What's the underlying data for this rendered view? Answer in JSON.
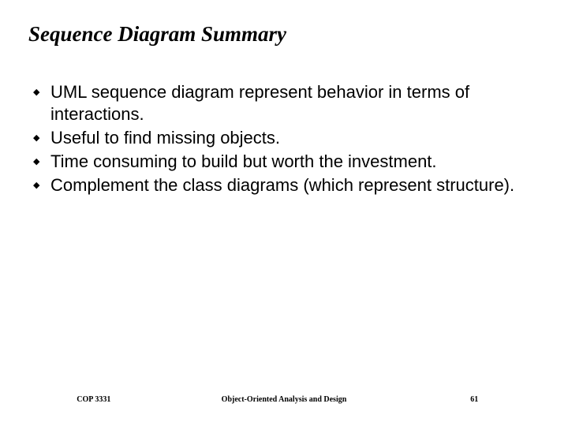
{
  "title": "Sequence Diagram Summary",
  "bullets": [
    "UML sequence diagram represent behavior in terms of interactions.",
    "Useful to find missing objects.",
    "Time consuming to build but worth the investment.",
    "Complement the class diagrams (which represent structure)."
  ],
  "footer": {
    "left": "COP 3331",
    "center": "Object-Oriented Analysis and Design",
    "right": "61"
  },
  "icon": "◆"
}
